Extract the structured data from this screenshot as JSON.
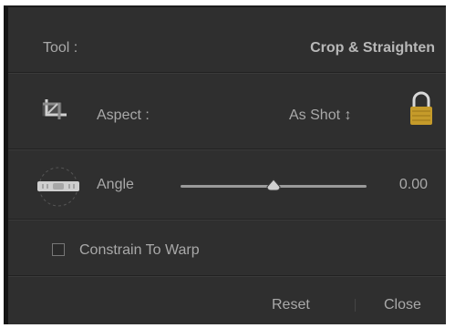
{
  "tool": {
    "label": "Tool :",
    "value": "Crop & Straighten"
  },
  "aspect": {
    "label": "Aspect :",
    "value": "As Shot ↕"
  },
  "angle": {
    "label": "Angle",
    "value": "0.00",
    "slider_fraction": 0.5
  },
  "constrain": {
    "label": "Constrain To Warp",
    "checked": false
  },
  "footer": {
    "reset_label": "Reset",
    "close_label": "Close"
  },
  "icons": {
    "crop": "crop-tool-icon",
    "lock": "lock-icon",
    "angle": "straighten-level-icon",
    "stepper": "updown-arrows-icon"
  }
}
